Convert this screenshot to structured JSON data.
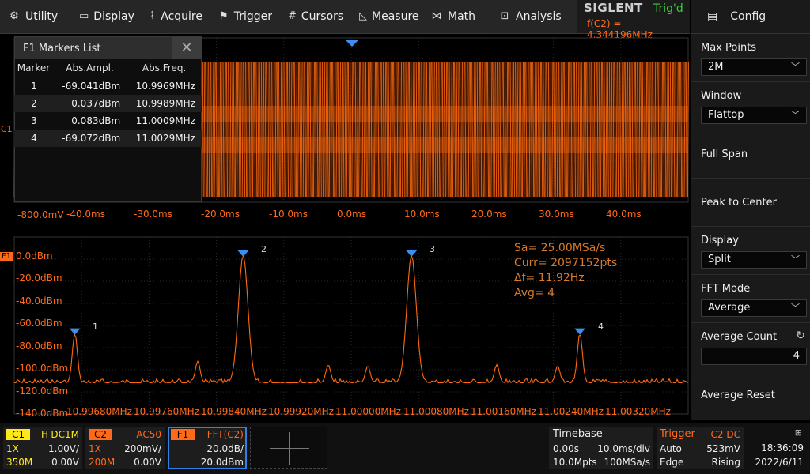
{
  "menu": [
    {
      "label": "Utility",
      "icon": "gear-icon"
    },
    {
      "label": "Display",
      "icon": "monitor-icon"
    },
    {
      "label": "Acquire",
      "icon": "acquire-icon"
    },
    {
      "label": "Trigger",
      "icon": "flag-icon"
    },
    {
      "label": "Cursors",
      "icon": "crosshair-icon"
    },
    {
      "label": "Measure",
      "icon": "measure-icon"
    },
    {
      "label": "Math",
      "icon": "math-icon"
    },
    {
      "label": "Analysis",
      "icon": "analysis-icon"
    }
  ],
  "brand": {
    "logo": "SIGLENT",
    "status": "Trig'd",
    "freq": "f(C2) = 4.344196MHz"
  },
  "config": {
    "title": "Config",
    "max_points_label": "Max Points",
    "max_points": "2M",
    "window_label": "Window",
    "window": "Flattop",
    "full_span": "Full Span",
    "peak_to_center": "Peak to Center",
    "display_label": "Display",
    "display": "Split",
    "fft_mode_label": "FFT Mode",
    "fft_mode": "Average",
    "avg_count_label": "Average Count",
    "avg_count": "4",
    "avg_reset": "Average Reset"
  },
  "markers": {
    "title": "F1 Markers List",
    "headers": [
      "Marker",
      "Abs.Ampl.",
      "Abs.Freq."
    ],
    "rows": [
      [
        "1",
        "-69.041dBm",
        "10.9969MHz"
      ],
      [
        "2",
        "0.037dBm",
        "10.9989MHz"
      ],
      [
        "3",
        "0.083dBm",
        "11.0009MHz"
      ],
      [
        "4",
        "-69.072dBm",
        "11.0029MHz"
      ]
    ]
  },
  "time_plot": {
    "ch_marker": "C1",
    "y_label": "-800.0mV",
    "x_ticks": [
      "-40.0ms",
      "-30.0ms",
      "-20.0ms",
      "-10.0ms",
      "0.0ms",
      "10.0ms",
      "20.0ms",
      "30.0ms",
      "40.0ms"
    ]
  },
  "fft_plot": {
    "ch_marker": "F1",
    "y_ticks": [
      "0.0dBm",
      "-20.0dBm",
      "-40.0dBm",
      "-60.0dBm",
      "-80.0dBm",
      "-100.0dBm",
      "-120.0dBm",
      "-140.0dBm"
    ],
    "x_ticks": [
      "10.99680MHz",
      "10.99760MHz",
      "10.99840MHz",
      "10.99920MHz",
      "11.00000MHz",
      "11.00080MHz",
      "11.00160MHz",
      "11.00240MHz",
      "11.00320MHz"
    ],
    "info": [
      "Sa=  25.00MSa/s",
      "Curr= 2097152pts",
      "Δf=  11.92Hz",
      "Avg= 4"
    ],
    "marker_labels": [
      "1",
      "2",
      "3",
      "4"
    ]
  },
  "chart_data": {
    "type": "line",
    "xlabel": "",
    "ylabel": "",
    "ylim": [
      -140,
      0
    ],
    "x_units": "MHz",
    "series": [
      {
        "x": [
          10.9968,
          10.9969,
          10.9976,
          10.9984,
          10.9989,
          10.9994,
          10.99996,
          11.0005,
          11.0009,
          11.0014,
          11.0021,
          11.0029,
          11.0032
        ],
        "values": [
          -115,
          -69.041,
          -110,
          -110,
          0.037,
          -100,
          -110,
          -105,
          0.083,
          -110,
          -110,
          -69.072,
          -117
        ]
      }
    ]
  },
  "status": {
    "c1": {
      "tag": "C1",
      "mode": "H",
      "coupling": "DC1M",
      "probe": "1X",
      "scale": "1.00V/",
      "bw": "350M",
      "offset": "0.00V"
    },
    "c2": {
      "tag": "C2",
      "coupling": "AC50",
      "probe": "1X",
      "scale": "200mV/",
      "bw": "200M",
      "offset": "0.00V"
    },
    "f1": {
      "tag": "F1",
      "src": "FFT(C2)",
      "scale": "20.0dB/",
      "ref": "20.0dBm"
    },
    "timebase": {
      "label": "Timebase",
      "delay": "0.00s",
      "scale": "10.0ms/div",
      "points": "10.0Mpts",
      "rate": "100MSa/s"
    },
    "trigger": {
      "label": "Trigger",
      "src": "C2 DC",
      "mode": "Auto",
      "level": "523mV",
      "type": "Edge",
      "slope": "Rising"
    },
    "clock": {
      "time": "18:36:09",
      "date": "2022/6/11"
    }
  },
  "colors": {
    "trace": "#ff6a10",
    "c1": "#ffe81a",
    "c2": "#ff6a1a",
    "marker": "#3a8ff0"
  }
}
